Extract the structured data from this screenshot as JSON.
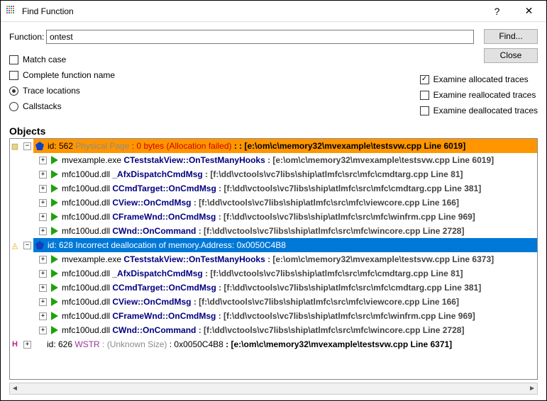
{
  "window": {
    "title": "Find Function"
  },
  "form": {
    "function_label": "Function:",
    "function_value": "ontest",
    "find_btn": "Find...",
    "close_btn": "Close"
  },
  "options": {
    "match_case": "Match case",
    "complete_name": "Complete function name",
    "trace_locations": "Trace locations",
    "callstacks": "Callstacks",
    "exam_alloc": "Examine allocated traces",
    "exam_realloc": "Examine reallocated traces",
    "exam_dealloc": "Examine deallocated traces"
  },
  "objects_header": "Objects",
  "nodes": {
    "n0_id": "id: 562 ",
    "n0_pp": "Physical Page ",
    "n0_sz": ": 0 bytes (Allocation failed)",
    "n0_loc": " :  : [e:\\om\\c\\memory32\\mvexample\\testsvw.cpp Line 6019]",
    "n0c0_m": "mvexample.exe ",
    "n0c0_f": "CTeststakView::OnTestManyHooks",
    "n0c0_l": " : [e:\\om\\c\\memory32\\mvexample\\testsvw.cpp Line 6019]",
    "n0c1_m": "mfc100ud.dll ",
    "n0c1_f": "_AfxDispatchCmdMsg",
    "n0c1_l": " : [f:\\dd\\vctools\\vc7libs\\ship\\atlmfc\\src\\mfc\\cmdtarg.cpp Line 81]",
    "n0c2_m": "mfc100ud.dll ",
    "n0c2_f": "CCmdTarget::OnCmdMsg",
    "n0c2_l": " : [f:\\dd\\vctools\\vc7libs\\ship\\atlmfc\\src\\mfc\\cmdtarg.cpp Line 381]",
    "n0c3_m": "mfc100ud.dll ",
    "n0c3_f": "CView::OnCmdMsg",
    "n0c3_l": " : [f:\\dd\\vctools\\vc7libs\\ship\\atlmfc\\src\\mfc\\viewcore.cpp Line 166]",
    "n0c4_m": "mfc100ud.dll ",
    "n0c4_f": "CFrameWnd::OnCmdMsg",
    "n0c4_l": " : [f:\\dd\\vctools\\vc7libs\\ship\\atlmfc\\src\\mfc\\winfrm.cpp Line 969]",
    "n0c5_m": "mfc100ud.dll ",
    "n0c5_f": "CWnd::OnCommand",
    "n0c5_l": " : [f:\\dd\\vctools\\vc7libs\\ship\\atlmfc\\src\\mfc\\wincore.cpp Line 2728]",
    "n1_txt": "id: 628 Incorrect deallocation of memory.Address: 0x0050C4B8",
    "n1c0_m": "mvexample.exe ",
    "n1c0_f": "CTeststakView::OnTestManyHooks",
    "n1c0_l": " : [e:\\om\\c\\memory32\\mvexample\\testsvw.cpp Line 6373]",
    "n1c1_m": "mfc100ud.dll ",
    "n1c1_f": "_AfxDispatchCmdMsg",
    "n1c1_l": " : [f:\\dd\\vctools\\vc7libs\\ship\\atlmfc\\src\\mfc\\cmdtarg.cpp Line 81]",
    "n1c2_m": "mfc100ud.dll ",
    "n1c2_f": "CCmdTarget::OnCmdMsg",
    "n1c2_l": " : [f:\\dd\\vctools\\vc7libs\\ship\\atlmfc\\src\\mfc\\cmdtarg.cpp Line 381]",
    "n1c3_m": "mfc100ud.dll ",
    "n1c3_f": "CView::OnCmdMsg",
    "n1c3_l": " : [f:\\dd\\vctools\\vc7libs\\ship\\atlmfc\\src\\mfc\\viewcore.cpp Line 166]",
    "n1c4_m": "mfc100ud.dll ",
    "n1c4_f": "CFrameWnd::OnCmdMsg",
    "n1c4_l": " : [f:\\dd\\vctools\\vc7libs\\ship\\atlmfc\\src\\mfc\\winfrm.cpp Line 969]",
    "n1c5_m": "mfc100ud.dll ",
    "n1c5_f": "CWnd::OnCommand",
    "n1c5_l": " : [f:\\dd\\vctools\\vc7libs\\ship\\atlmfc\\src\\mfc\\wincore.cpp Line 2728]",
    "n2_id": "id: 626 ",
    "n2_w": "WSTR ",
    "n2_sz": ": (Unknown Size)",
    "n2_addr": " :  0x0050C4B8 ",
    "n2_loc": ": [e:\\om\\c\\memory32\\mvexample\\testsvw.cpp Line 6371]"
  }
}
